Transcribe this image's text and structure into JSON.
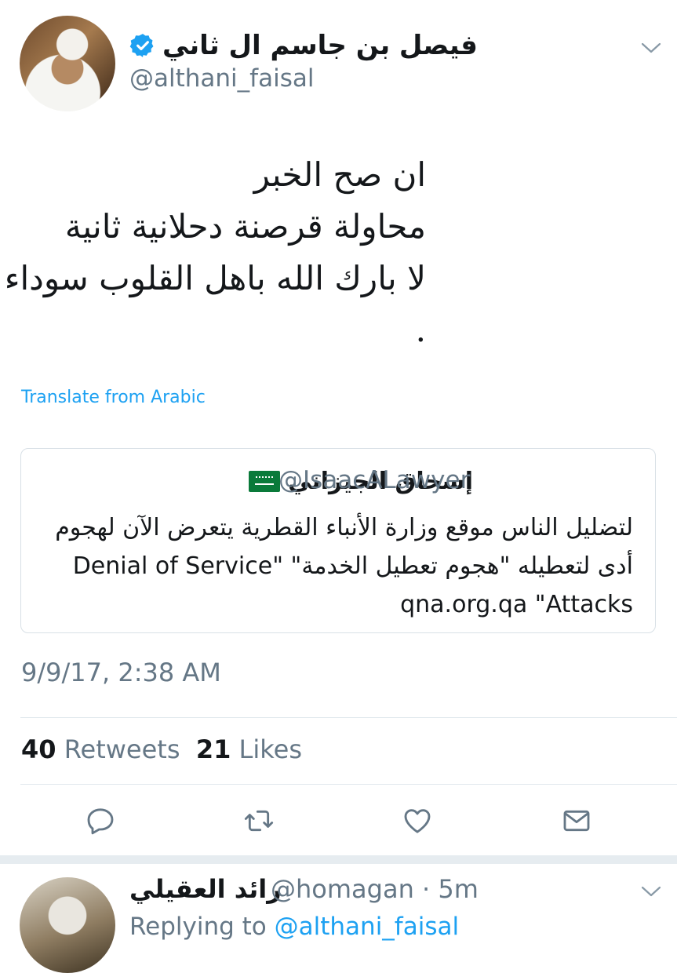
{
  "tweet": {
    "author_name": "فيصل بن جاسم ال ثاني",
    "author_handle": "@althani_faisal",
    "text_lines": [
      "ان صح الخبر",
      "محاولة قرصنة دحلانية ثانية",
      "لا بارك الله باهل القلوب سوداء",
      "."
    ],
    "translate_label": "Translate from Arabic",
    "timestamp": "9/9/17, 2:38 AM",
    "retweets_count": "40",
    "retweets_label": "Retweets",
    "likes_count": "21",
    "likes_label": "Likes"
  },
  "quoted_tweet": {
    "author_name": "إسحاق الجيزاني",
    "author_handle": "@IsaacALawyer",
    "body_lines": [
      "لتضليل الناس موقع وزارة الأنباء القطرية يتعرض الآن لهجوم",
      "أدى لتعطيله \"هجوم تعطيل الخدمة\" \"Denial of Service",
      "qna.org.qa \"Attacks"
    ]
  },
  "reply": {
    "author_name": "رائد العقيلي",
    "author_handle": "@homagan",
    "time": "· 5m",
    "replying_prefix": "Replying to",
    "replying_to": "@althani_faisal"
  },
  "icons": {
    "verified": "verified-badge-icon",
    "chevron": "chevron-down-icon",
    "reply": "reply-icon",
    "retweet": "retweet-icon",
    "like": "heart-icon",
    "dm": "envelope-icon",
    "flag": "saudi-flag-icon"
  },
  "colors": {
    "accent": "#1da1f2",
    "secondary_text": "#657786",
    "primary_text": "#14171a",
    "divider": "#e1e8ed"
  }
}
